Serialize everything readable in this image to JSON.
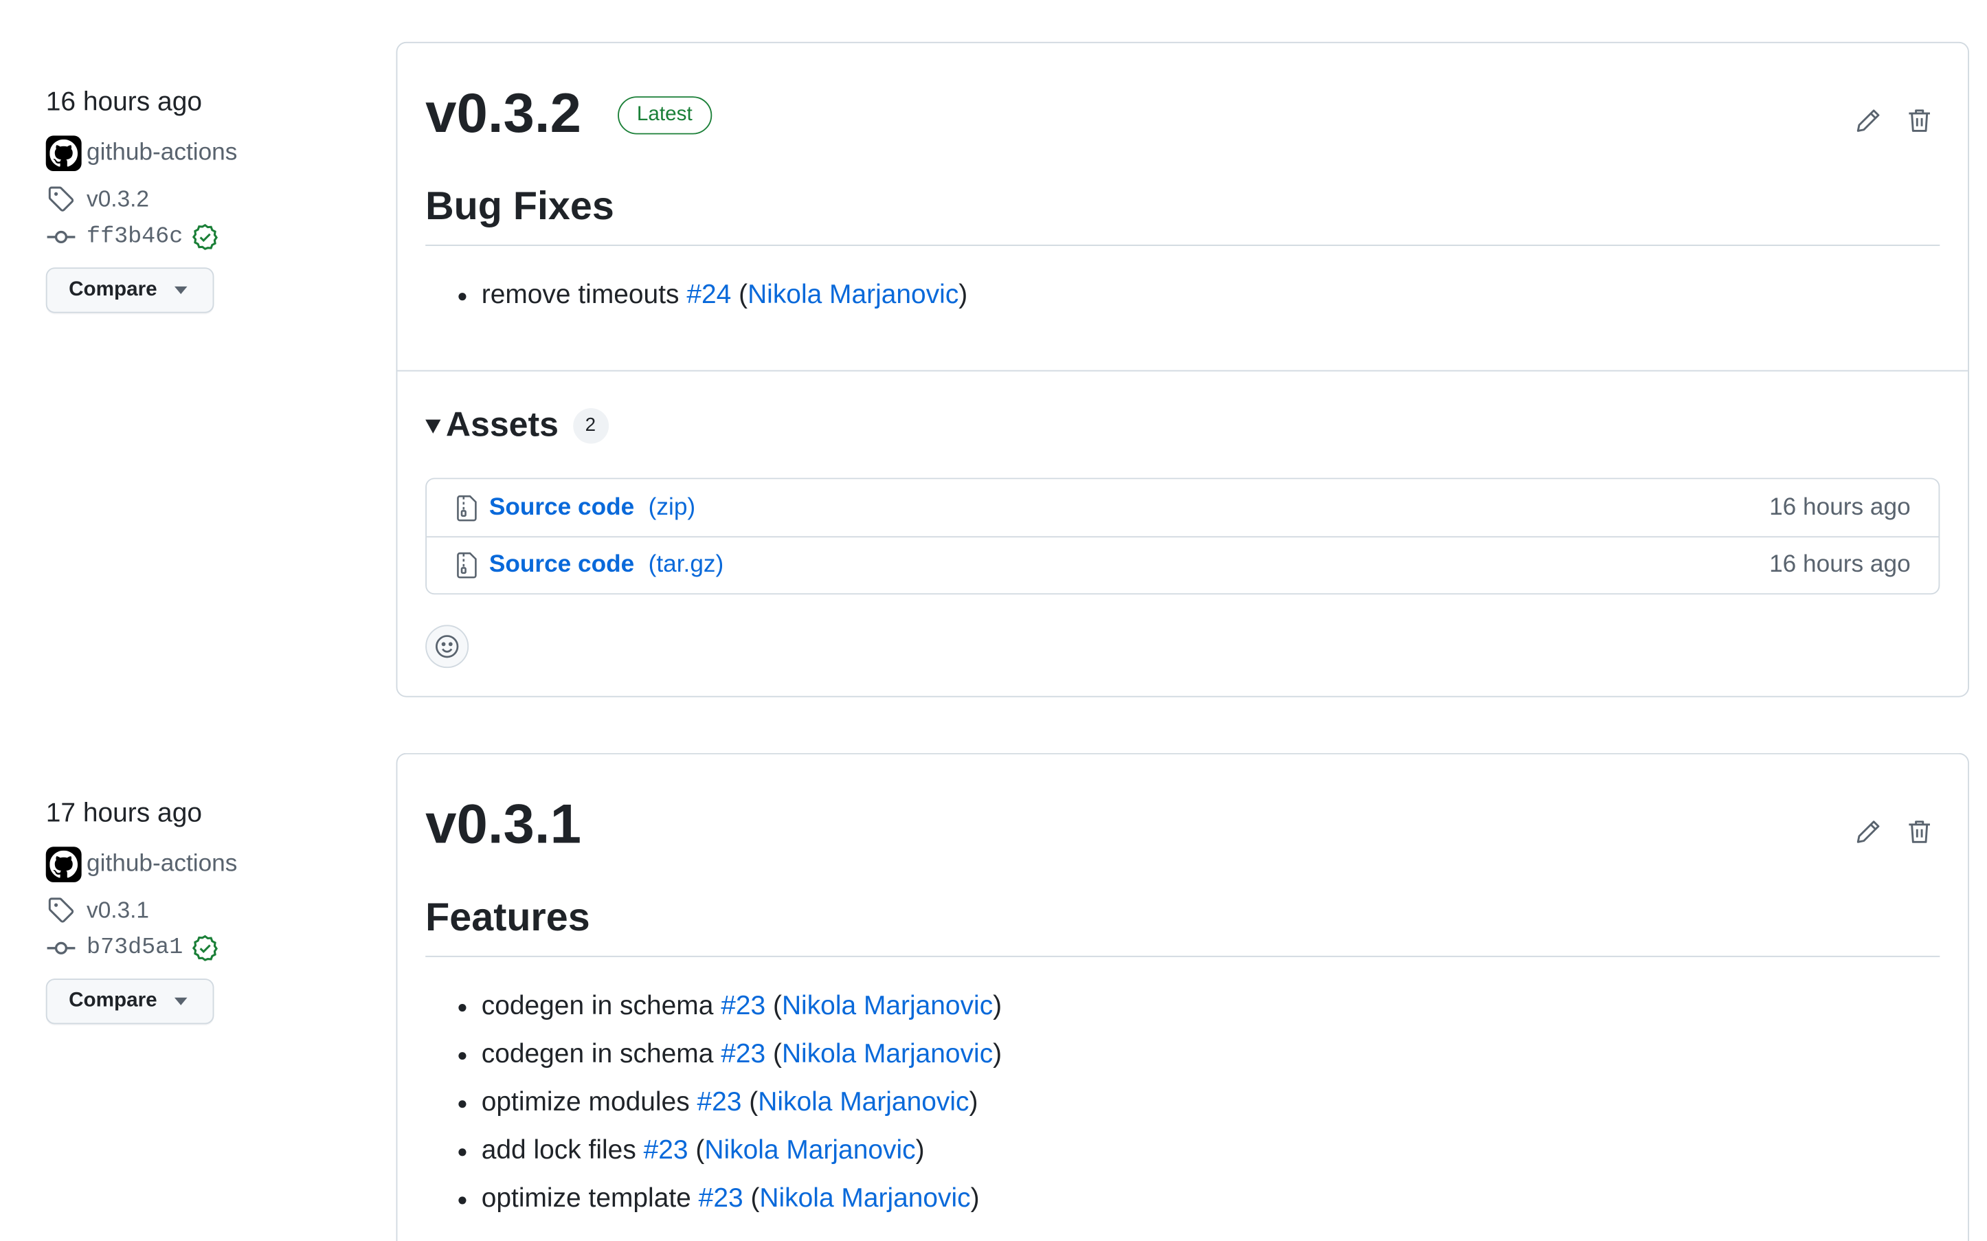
{
  "releases": [
    {
      "time": "16 hours ago",
      "author": "github-actions",
      "tag": "v0.3.2",
      "commit": "ff3b46c",
      "compare_label": "Compare",
      "title": "v0.3.2",
      "badge": "Latest",
      "section": "Bug Fixes",
      "notes": [
        {
          "text": "remove timeouts ",
          "pr": "#24",
          "open": " (",
          "author": "Nikola Marjanovic",
          "close": ")"
        }
      ],
      "assets": {
        "heading": "Assets",
        "count": "2",
        "items": [
          {
            "name": "Source code",
            "format": "(zip)",
            "time": "16 hours ago"
          },
          {
            "name": "Source code",
            "format": "(tar.gz)",
            "time": "16 hours ago"
          }
        ]
      }
    },
    {
      "time": "17 hours ago",
      "author": "github-actions",
      "tag": "v0.3.1",
      "commit": "b73d5a1",
      "compare_label": "Compare",
      "title": "v0.3.1",
      "section": "Features",
      "notes": [
        {
          "text": "codegen in schema ",
          "pr": "#23",
          "open": " (",
          "author": "Nikola Marjanovic",
          "close": ")"
        },
        {
          "text": "codegen in schema ",
          "pr": "#23",
          "open": " (",
          "author": "Nikola Marjanovic",
          "close": ")"
        },
        {
          "text": "optimize modules ",
          "pr": "#23",
          "open": " (",
          "author": "Nikola Marjanovic",
          "close": ")"
        },
        {
          "text": "add lock files ",
          "pr": "#23",
          "open": " (",
          "author": "Nikola Marjanovic",
          "close": ")"
        },
        {
          "text": "optimize template ",
          "pr": "#23",
          "open": " (",
          "author": "Nikola Marjanovic",
          "close": ")"
        }
      ]
    }
  ],
  "colors": {
    "link": "#0969da",
    "verified": "#1a7f37",
    "border": "#d1d9e0",
    "muted": "#59636e"
  },
  "icons": [
    "github-avatar-icon",
    "tag-icon",
    "commit-icon",
    "verified-check-icon",
    "pencil-icon",
    "trash-icon",
    "file-zip-icon",
    "smiley-icon",
    "triangle-down-icon"
  ]
}
